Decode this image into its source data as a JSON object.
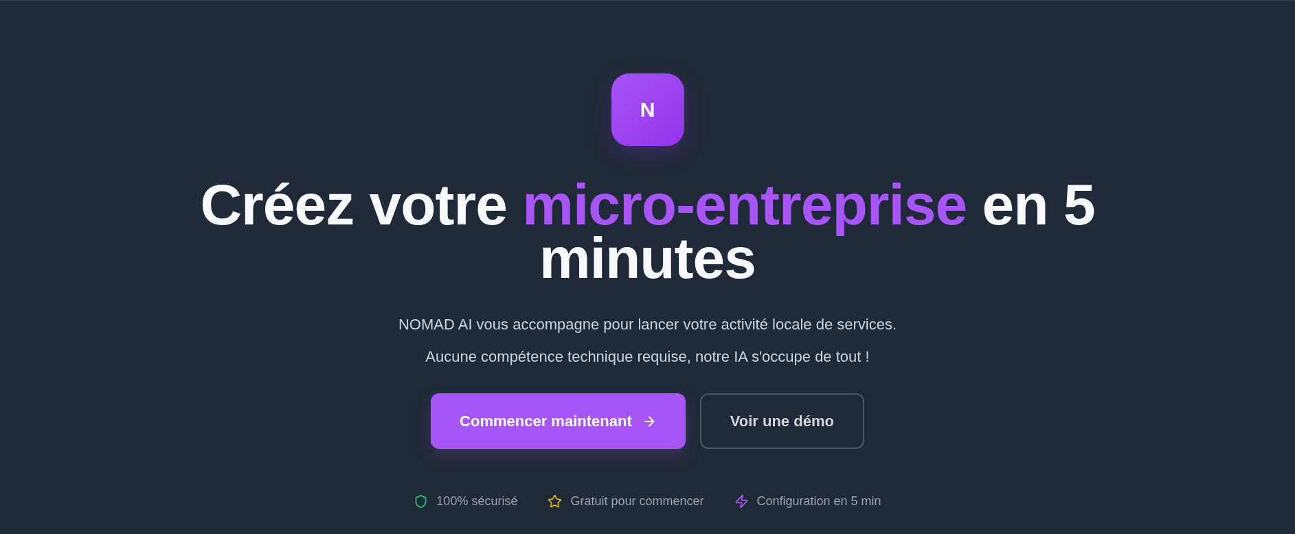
{
  "logo": {
    "letter": "N"
  },
  "headline": [
    {
      "text": "Créez votre ",
      "highlight": false
    },
    {
      "text": "micro-entreprise",
      "highlight": true
    },
    {
      "text": " en 5 minutes",
      "highlight": false
    }
  ],
  "subtitle_lines": [
    "NOMAD AI vous accompagne pour lancer votre activité locale de services.",
    "Aucune compétence technique requise, notre IA s'occupe de tout !"
  ],
  "buttons": [
    {
      "label": "Commencer maintenant",
      "kind": "primary"
    },
    {
      "label": "Voir une démo",
      "kind": "secondary"
    }
  ],
  "features": [
    {
      "label": "100% sécurisé",
      "kind": "shield",
      "color": "#22c55e"
    },
    {
      "label": "Gratuit pour commencer",
      "kind": "star",
      "color": "#eab308"
    },
    {
      "label": "Configuration en 5 min",
      "kind": "bolt",
      "color": "#a855f7"
    }
  ]
}
